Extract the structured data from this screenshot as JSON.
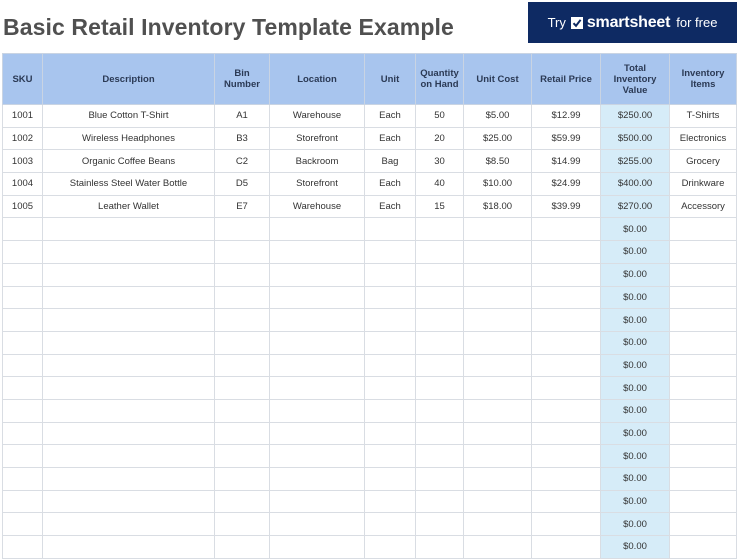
{
  "page_title": "Basic Retail Inventory Template Example",
  "banner": {
    "try": "Try",
    "brand": "smartsheet",
    "suffix": "for free"
  },
  "columns": [
    "SKU",
    "Description",
    "Bin Number",
    "Location",
    "Unit",
    "Quantity on Hand",
    "Unit Cost",
    "Retail Price",
    "Total Inventory Value",
    "Inventory Items"
  ],
  "rows": [
    [
      "1001",
      "Blue Cotton T-Shirt",
      "A1",
      "Warehouse",
      "Each",
      "50",
      "$5.00",
      "$12.99",
      "$250.00",
      "T-Shirts"
    ],
    [
      "1002",
      "Wireless Headphones",
      "B3",
      "Storefront",
      "Each",
      "20",
      "$25.00",
      "$59.99",
      "$500.00",
      "Electronics"
    ],
    [
      "1003",
      "Organic Coffee Beans",
      "C2",
      "Backroom",
      "Bag",
      "30",
      "$8.50",
      "$14.99",
      "$255.00",
      "Grocery"
    ],
    [
      "1004",
      "Stainless Steel Water Bottle",
      "D5",
      "Storefront",
      "Each",
      "40",
      "$10.00",
      "$24.99",
      "$400.00",
      "Drinkware"
    ],
    [
      "1005",
      "Leather Wallet",
      "E7",
      "Warehouse",
      "Each",
      "15",
      "$18.00",
      "$39.99",
      "$270.00",
      "Accessory"
    ],
    [
      "",
      "",
      "",
      "",
      "",
      "",
      "",
      "",
      "$0.00",
      ""
    ],
    [
      "",
      "",
      "",
      "",
      "",
      "",
      "",
      "",
      "$0.00",
      ""
    ],
    [
      "",
      "",
      "",
      "",
      "",
      "",
      "",
      "",
      "$0.00",
      ""
    ],
    [
      "",
      "",
      "",
      "",
      "",
      "",
      "",
      "",
      "$0.00",
      ""
    ],
    [
      "",
      "",
      "",
      "",
      "",
      "",
      "",
      "",
      "$0.00",
      ""
    ],
    [
      "",
      "",
      "",
      "",
      "",
      "",
      "",
      "",
      "$0.00",
      ""
    ],
    [
      "",
      "",
      "",
      "",
      "",
      "",
      "",
      "",
      "$0.00",
      ""
    ],
    [
      "",
      "",
      "",
      "",
      "",
      "",
      "",
      "",
      "$0.00",
      ""
    ],
    [
      "",
      "",
      "",
      "",
      "",
      "",
      "",
      "",
      "$0.00",
      ""
    ],
    [
      "",
      "",
      "",
      "",
      "",
      "",
      "",
      "",
      "$0.00",
      ""
    ],
    [
      "",
      "",
      "",
      "",
      "",
      "",
      "",
      "",
      "$0.00",
      ""
    ],
    [
      "",
      "",
      "",
      "",
      "",
      "",
      "",
      "",
      "$0.00",
      ""
    ],
    [
      "",
      "",
      "",
      "",
      "",
      "",
      "",
      "",
      "$0.00",
      ""
    ],
    [
      "",
      "",
      "",
      "",
      "",
      "",
      "",
      "",
      "$0.00",
      ""
    ],
    [
      "",
      "",
      "",
      "",
      "",
      "",
      "",
      "",
      "$0.00",
      ""
    ]
  ],
  "colors": {
    "header_bg": "#a8c5ee",
    "total_col_bg": "#d6ecf8",
    "banner_bg": "#0e2a63"
  },
  "icons": {
    "banner_check": "checkmark-icon"
  }
}
